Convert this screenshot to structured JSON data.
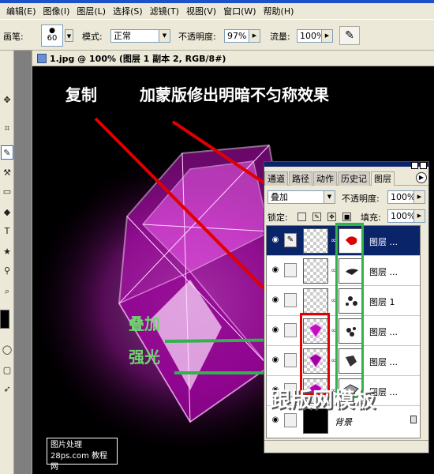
{
  "menubar": {
    "items": [
      "编辑(E)",
      "图像(I)",
      "图层(L)",
      "选择(S)",
      "滤镜(T)",
      "视图(V)",
      "窗口(W)",
      "帮助(H)"
    ]
  },
  "options": {
    "brush_label": "画笔:",
    "brush_size": "60",
    "mode_label": "模式:",
    "mode_value": "正常",
    "opacity_label": "不透明度:",
    "opacity_value": "97%",
    "flow_label": "流量:",
    "flow_value": "100%"
  },
  "document": {
    "title": "1.jpg @ 100% (图层 1 副本 2, RGB/8#)"
  },
  "annotations": {
    "copy": "复制",
    "mask_note": "加蒙版修出明暗不匀称效果",
    "overlay": "叠加",
    "hardlight": "强光"
  },
  "watermark": {
    "box_line1": "图片处理",
    "box_line2": "28ps.com 教程网",
    "bottom": "跟版网模板"
  },
  "layers_panel": {
    "tabs": [
      "通道",
      "路径",
      "动作",
      "历史记",
      "图层"
    ],
    "blend_mode": "叠加",
    "opacity_label": "不透明度:",
    "opacity_value": "100%",
    "lock_label": "锁定:",
    "fill_label": "填充:",
    "fill_value": "100%",
    "layers": [
      {
        "name": "图层 ..."
      },
      {
        "name": "图层 ..."
      },
      {
        "name": "图层 1"
      },
      {
        "name": "图层 ..."
      },
      {
        "name": "图层 ..."
      },
      {
        "name": "图层 ..."
      },
      {
        "name": "背景"
      }
    ]
  },
  "colors": {
    "annotation_red": "#e00000",
    "annotation_green": "#2fb34a",
    "diamond": "#e020e0",
    "selection": "#0a246a"
  }
}
